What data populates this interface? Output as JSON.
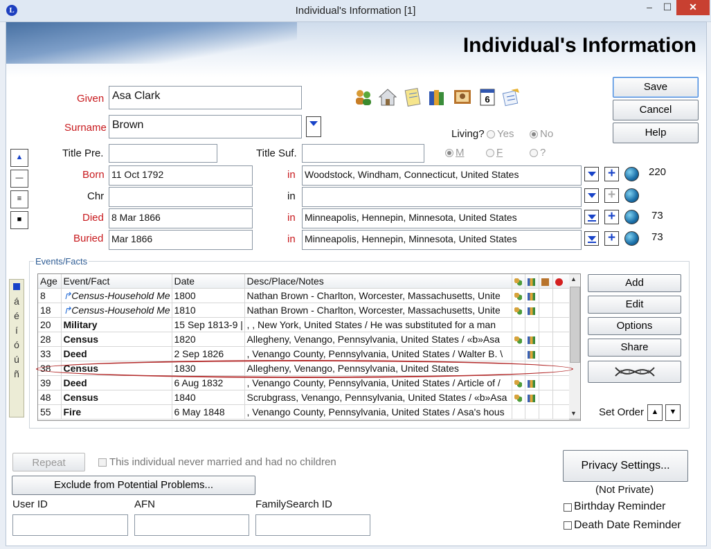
{
  "window": {
    "title": "Individual's Information  [1]",
    "app_icon": "L",
    "minimize": "–",
    "maximize": "☐",
    "close": "✕"
  },
  "header": {
    "title": "Individual's Information"
  },
  "fields": {
    "given_label": "Given",
    "given_value": "Asa Clark",
    "surname_label": "Surname",
    "surname_value": "Brown",
    "title_pre_label": "Title Pre.",
    "title_pre_value": "",
    "title_suf_label": "Title Suf.",
    "title_suf_value": "",
    "born_label": "Born",
    "born_date": "11 Oct 1792",
    "born_place": "Woodstock, Windham, Connecticut, United States",
    "born_count": "220",
    "chr_label": "Chr",
    "chr_date": "",
    "chr_place": "",
    "died_label": "Died",
    "died_date": "8 Mar 1866",
    "died_place": "Minneapolis, Hennepin, Minnesota, United States",
    "died_count": "73",
    "buried_label": "Buried",
    "buried_date": "Mar 1866",
    "buried_place": "Minneapolis, Hennepin, Minnesota, United States",
    "buried_count": "73",
    "in_label": "in"
  },
  "living": {
    "label": "Living?",
    "yes": "Yes",
    "no": "No",
    "selected": "No"
  },
  "sex": {
    "male": "M",
    "female": "F",
    "unknown": "?",
    "selected": "M"
  },
  "buttons": {
    "save": "Save",
    "cancel": "Cancel",
    "help": "Help",
    "add": "Add",
    "edit": "Edit",
    "options": "Options",
    "share": "Share",
    "repeat": "Repeat",
    "exclude": "Exclude from Potential Problems...",
    "privacy": "Privacy Settings..."
  },
  "toolbar_icons": [
    "family-icon",
    "house-icon",
    "notes-icon",
    "sources-icon",
    "pictures-icon",
    "calendar-icon",
    "todo-icon"
  ],
  "calendar_day": "6",
  "events": {
    "group_title": "Events/Facts",
    "columns": [
      "Age",
      "Event/Fact",
      "Date",
      "Desc/Place/Notes"
    ],
    "rows": [
      {
        "age": "8",
        "event": "Census-Household Me",
        "date": "1800",
        "desc": "Nathan Brown - Charlton, Worcester, Massachusetts, Unite"
      },
      {
        "age": "18",
        "event": "Census-Household Me",
        "date": "1810",
        "desc": "Nathan Brown - Charlton, Worcester, Massachusetts, Unite"
      },
      {
        "age": "20",
        "event": "Military",
        "date": "15 Sep 1813-9 |",
        "desc": ", , New York, United States / He was substituted for a man "
      },
      {
        "age": "28",
        "event": "Census",
        "date": "1820",
        "desc": "Allegheny, Venango, Pennsylvania, United States / «b»Asa"
      },
      {
        "age": "33",
        "event": "Deed",
        "date": "2 Sep 1826",
        "desc": ", Venango County, Pennsylvania, United States / Walter B. \\"
      },
      {
        "age": "38",
        "event": "Census",
        "date": "1830",
        "desc": "Allegheny, Venango, Pennsylvania, United States"
      },
      {
        "age": "39",
        "event": "Deed",
        "date": "6 Aug 1832",
        "desc": ", Venango County, Pennsylvania, United States / Article of /"
      },
      {
        "age": "48",
        "event": "Census",
        "date": "1840",
        "desc": "Scrubgrass, Venango, Pennsylvania, United States / «b»Asa"
      },
      {
        "age": "55",
        "event": "Fire",
        "date": "6 May 1848",
        "desc": ", Venango County, Pennsylvania, United States / Asa's hous"
      }
    ],
    "set_order_label": "Set Order"
  },
  "side_letters": [
    "á",
    "é",
    "í",
    "ó",
    "ú",
    "ñ"
  ],
  "bottom": {
    "never_married": "This individual never married and had no children",
    "user_id_label": "User ID",
    "afn_label": "AFN",
    "familysearch_label": "FamilySearch ID",
    "not_private": "(Not Private)",
    "birthday_reminder": "Birthday Reminder",
    "death_reminder": "Death Date Reminder"
  }
}
